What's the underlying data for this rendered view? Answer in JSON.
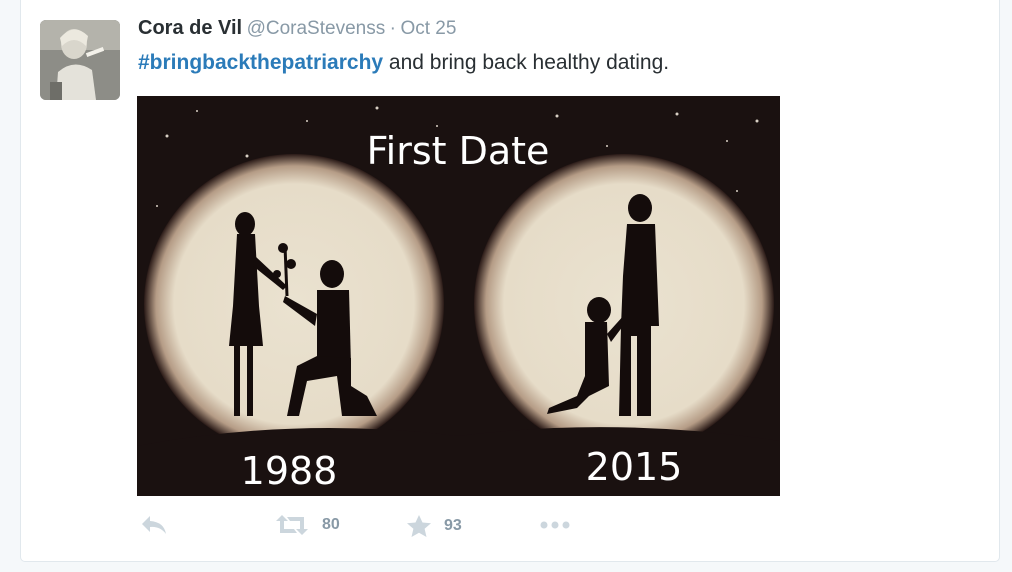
{
  "tweet": {
    "author_name": "Cora de Vil",
    "handle": "@CoraStevenss",
    "separator": "·",
    "date": "Oct 25",
    "hashtag": "#bringbackthepatriarchy",
    "text_rest": " and bring back healthy dating.",
    "media": {
      "title": "First Date",
      "left_year": "1988",
      "right_year": "2015"
    }
  },
  "actions": {
    "reply_icon": "reply-icon",
    "retweet_icon": "retweet-icon",
    "retweet_count": "80",
    "favorite_icon": "star-icon",
    "favorite_count": "93",
    "more_icon": "more-dots-icon"
  },
  "colors": {
    "link": "#2b7bb9",
    "text": "#292f33",
    "muted": "#8899a6",
    "image_bg": "#1a1110"
  }
}
